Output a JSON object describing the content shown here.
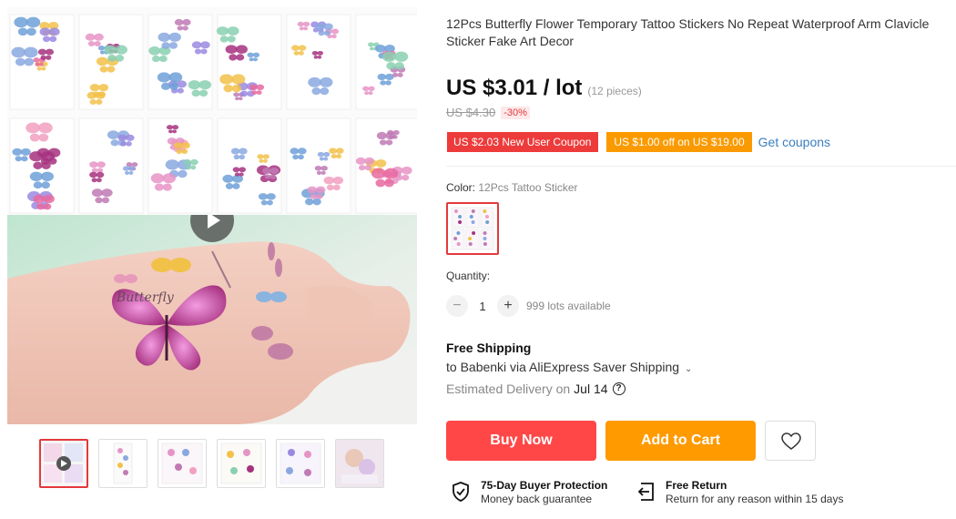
{
  "product": {
    "title": "12Pcs Butterfly Flower Temporary Tattoo Stickers No Repeat Waterproof Arm Clavicle Sticker Fake Art Decor",
    "price": "US $3.01 / lot",
    "price_unit": "(12 pieces)",
    "original_price": "US $4.30",
    "discount": "-30%"
  },
  "coupons": {
    "new_user": "US $2.03 New User Coupon",
    "store": "US $1.00 off on US $19.00",
    "get_link": "Get coupons"
  },
  "color": {
    "label": "Color:",
    "value": "12Pcs Tattoo Sticker"
  },
  "quantity": {
    "label": "Quantity:",
    "minus": "−",
    "value": "1",
    "plus": "+",
    "available": "999 lots available"
  },
  "shipping": {
    "title": "Free Shipping",
    "line": "to Babenki via AliExpress Saver Shipping",
    "chevron": "⌄",
    "delivery_label": "Estimated Delivery on",
    "delivery_date": "Jul 14",
    "help": "?"
  },
  "actions": {
    "buy_now": "Buy Now",
    "add_to_cart": "Add to Cart",
    "wishlist_icon": "heart-icon"
  },
  "assurances": [
    {
      "title": "75-Day Buyer Protection",
      "subtitle": "Money back guarantee",
      "icon": "shield-check-icon"
    },
    {
      "title": "Free Return",
      "subtitle": "Return for any reason within 15 days",
      "icon": "return-arrow-icon"
    }
  ],
  "gallery": {
    "thumbnail_count": 6,
    "active_thumbnail": 1,
    "play_icon": "play-icon"
  },
  "colors": {
    "accent_red": "#ff4747",
    "accent_orange": "#ff9a00",
    "coupon_red": "#ed3b3b",
    "coupon_orange": "#fb9a00",
    "link_blue": "#3a7fbf"
  }
}
